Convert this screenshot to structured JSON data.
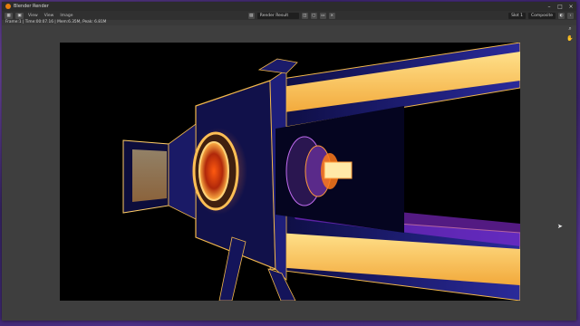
{
  "window": {
    "title": "Blender Render"
  },
  "header": {
    "menus": [
      "View",
      "View",
      "Image"
    ],
    "image_name": "Render Result",
    "slot": "Slot 1",
    "pass": "Composite"
  },
  "infobar": {
    "text": "Frame:1 | Time:00:07.16 | Mem:6.35M, Peak: 6.81M"
  },
  "colors": {
    "accent": "#e87d0d",
    "gold": "#f2b84b",
    "navy": "#1a1a6b",
    "magenta": "#8a2bd8"
  },
  "icons": {
    "app": "blender-icon",
    "zoom": "zoom-icon",
    "hand": "hand-icon",
    "camera": "camera-icon"
  }
}
